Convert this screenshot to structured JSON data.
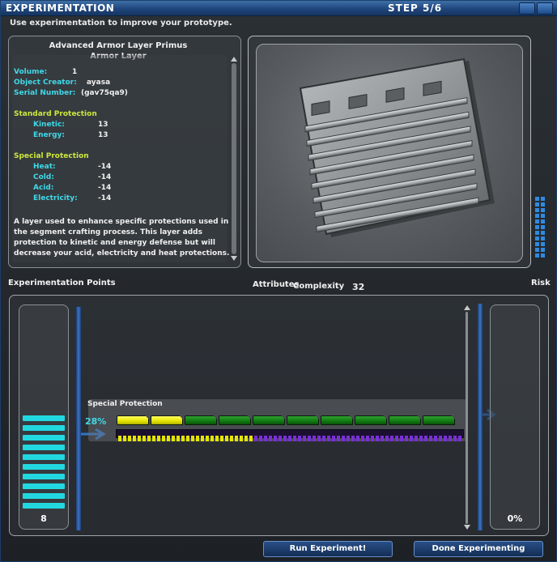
{
  "window": {
    "title": "EXPERIMENTATION",
    "step": "STEP 5/6",
    "instruction": "Use experimentation to improve your prototype."
  },
  "item": {
    "name": "Advanced Armor Layer Primus",
    "type": "Armor Layer",
    "volume_label": "Volume:",
    "volume": "1",
    "creator_label": "Object Creator:",
    "creator": "ayasa",
    "serial_label": "Serial Number:",
    "serial": "(gav75qa9)",
    "standard_header": "Standard Protection",
    "standard": [
      {
        "label": "Kinetic:",
        "value": "13"
      },
      {
        "label": "Energy:",
        "value": "13"
      }
    ],
    "special_header": "Special Protection",
    "special": [
      {
        "label": "Heat:",
        "value": "-14"
      },
      {
        "label": "Cold:",
        "value": "-14"
      },
      {
        "label": "Acid:",
        "value": "-14"
      },
      {
        "label": "Electricity:",
        "value": "-14"
      }
    ],
    "description": "A layer used to enhance specific protections used in the segment crafting process.  This layer adds protection to kinetic and energy defense but will decrease your acid, electricity and heat protections."
  },
  "preview": {
    "complexity_label": "Complexity",
    "complexity": "32"
  },
  "experiment": {
    "points_header": "Experimentation Points",
    "attributes_header": "Attributes",
    "risk_header": "Risk",
    "points_value": "8",
    "points_remaining_bars": 10,
    "risk_value": "0%",
    "attribute": {
      "name": "Special Protection",
      "percent": "28%",
      "segments_total": 10,
      "segments_filled": 2,
      "progress_fraction": 0.28
    }
  },
  "buttons": {
    "run": "Run Experiment!",
    "done": "Done Experimenting"
  },
  "colors": {
    "title_bar": "#2a5a98",
    "cyan_text": "#3fd9e8",
    "section_header": "#cde83c",
    "segment_on": "#e4e400",
    "segment_off": "#117a11",
    "progress_on": "#e4e400",
    "progress_off": "#7a2fd8",
    "points_bar": "#22d8e0"
  }
}
